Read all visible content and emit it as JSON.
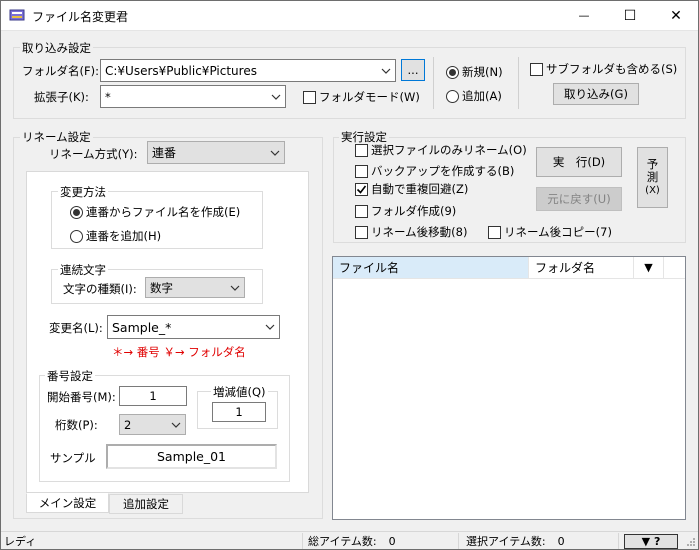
{
  "window": {
    "title": "ファイル名変更君",
    "minimize_glyph": "—",
    "maximize_glyph": "☐",
    "close_glyph": "✕"
  },
  "import_settings": {
    "group_label": "取り込み設定",
    "folder_label": "フォルダ名(F):",
    "folder_value": "C:¥Users¥Public¥Pictures",
    "browse_label": "...",
    "ext_label": "拡張子(K):",
    "ext_value": "*",
    "folder_mode_label": "フォルダモード(W)",
    "folder_mode_checked": false,
    "new_label": "新規(N)",
    "append_label": "追加(A)",
    "mode_selected": "new",
    "subfolder_label": "サブフォルダも含める(S)",
    "subfolder_checked": false,
    "import_button": "取り込み(G)"
  },
  "rename_settings": {
    "group_label": "リネーム設定",
    "method_label": "リネーム方式(Y):",
    "method_value": "連番",
    "change_method": {
      "label": "変更方法",
      "option1": "連番からファイル名を作成(E)",
      "option2": "連番を追加(H)",
      "selected": 1
    },
    "sequence_char": {
      "label": "連続文字",
      "type_label": "文字の種類(I):",
      "type_value": "数字"
    },
    "new_name_label": "変更名(L):",
    "new_name_value": "Sample_*",
    "hint": "＊→ 番号 ￥→ フォルダ名",
    "number_settings": {
      "label": "番号設定",
      "start_label": "開始番号(M):",
      "start_value": "1",
      "digits_label": "桁数(P):",
      "digits_value": "2",
      "increment_label": "増減値(Q)",
      "increment_value": "1"
    },
    "sample_label": "サンプル",
    "sample_value": "Sample_01",
    "tabs": [
      "メイン設定",
      "追加設定"
    ],
    "active_tab": 0
  },
  "exec_settings": {
    "group_label": "実行設定",
    "options": [
      {
        "label": "選択ファイルのみリネーム(O)",
        "checked": false
      },
      {
        "label": "バックアップを作成する(B)",
        "checked": false
      },
      {
        "label": "自動で重複回避(Z)",
        "checked": true
      },
      {
        "label": "フォルダ作成(9)",
        "checked": false
      },
      {
        "label": "リネーム後移動(8)",
        "checked": false
      },
      {
        "label": "リネーム後コピー(7)",
        "checked": false
      }
    ],
    "run_button": "実　行(D)",
    "undo_button": "元に戻す(U)",
    "predict_button": [
      "予",
      "測",
      "(X)"
    ]
  },
  "file_list": {
    "columns": [
      "ファイル名",
      "フォルダ名"
    ],
    "sort_glyph": "▼"
  },
  "status_bar": {
    "status": "レディ",
    "total_label": "総アイテム数:",
    "total_value": "0",
    "selected_label": "選択アイテム数:",
    "selected_value": "0",
    "help_button": "▼ ?"
  },
  "colors": {
    "hint": "#e00000",
    "list_header_highlight": "#d9ebf9"
  }
}
